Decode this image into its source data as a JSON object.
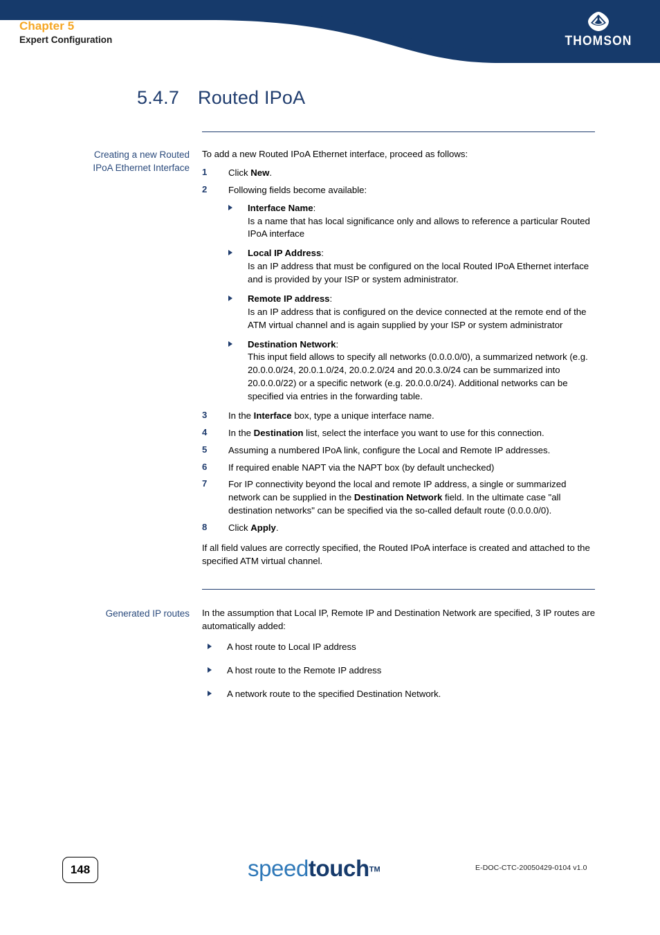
{
  "header": {
    "chapter": "Chapter 5",
    "chapter_sub": "Expert Configuration",
    "brand": "THOMSON",
    "band_color": "#163A6B",
    "chapter_color": "#F5A623"
  },
  "section": {
    "number": "5.4.7",
    "title": "Routed IPoA",
    "color": "#1F3C6E"
  },
  "creating": {
    "side_heading_line1": "Creating a new Routed",
    "side_heading_line2": "IPoA Ethernet Interface",
    "intro": "To add a new Routed IPoA Ethernet interface, proceed as follows:",
    "steps": [
      {
        "num": "1",
        "pre": "Click ",
        "bold": "New",
        "post": "."
      },
      {
        "num": "2",
        "pre": "Following fields become available:",
        "bold": "",
        "post": ""
      }
    ],
    "fields": [
      {
        "term": "Interface Name",
        "desc": "Is a name that has local significance only and allows to reference a particular Routed IPoA interface"
      },
      {
        "term": "Local IP Address",
        "desc": "Is an IP address that must be configured on the local Routed IPoA Ethernet interface and is provided by your ISP or system administrator."
      },
      {
        "term": "Remote IP address",
        "desc": "Is an IP address that is configured on the device connected at the remote end of the ATM virtual channel and is again supplied by your ISP or system administrator"
      },
      {
        "term": "Destination Network",
        "desc": "This input field allows to specify all networks (0.0.0.0/0), a summarized network (e.g. 20.0.0.0/24, 20.0.1.0/24, 20.0.2.0/24 and 20.0.3.0/24 can be summarized into 20.0.0.0/22) or a specific network (e.g. 20.0.0.0/24). Additional networks can be specified via entries in the forwarding table."
      }
    ],
    "steps2": [
      {
        "num": "3",
        "pre": "In the ",
        "bold": "Interface",
        "post": " box, type a unique interface name."
      },
      {
        "num": "4",
        "pre": "In the ",
        "bold": "Destination",
        "post": " list, select the interface you want to use for this connection."
      },
      {
        "num": "5",
        "pre": "Assuming a numbered IPoA link, configure the Local and Remote IP addresses.",
        "bold": "",
        "post": ""
      },
      {
        "num": "6",
        "pre": "If required enable NAPT via the NAPT box (by default unchecked)",
        "bold": "",
        "post": ""
      },
      {
        "num": "7",
        "pre": "For IP connectivity beyond the local and remote IP address, a single or summarized network can be supplied in the ",
        "bold": "Destination Network",
        "post": " field. In the ultimate case \"all destination networks\" can be specified via the so-called default route (0.0.0.0/0)."
      },
      {
        "num": "8",
        "pre": "Click ",
        "bold": "Apply",
        "post": "."
      }
    ],
    "closing": "If all field values are correctly specified, the Routed IPoA interface is created and attached to the specified ATM virtual channel."
  },
  "generated": {
    "side_heading": "Generated IP routes",
    "intro": "In the assumption that Local IP, Remote IP and Destination Network are specified, 3 IP routes are automatically added:",
    "routes": [
      "A host route to Local IP address",
      "A host route to the Remote IP address",
      "A network route to the specified Destination Network."
    ]
  },
  "footer": {
    "page_number": "148",
    "brand_speed": "speed",
    "brand_touch": "touch",
    "brand_tm": "TM",
    "doc_ref": "E-DOC-CTC-20050429-0104 v1.0"
  }
}
